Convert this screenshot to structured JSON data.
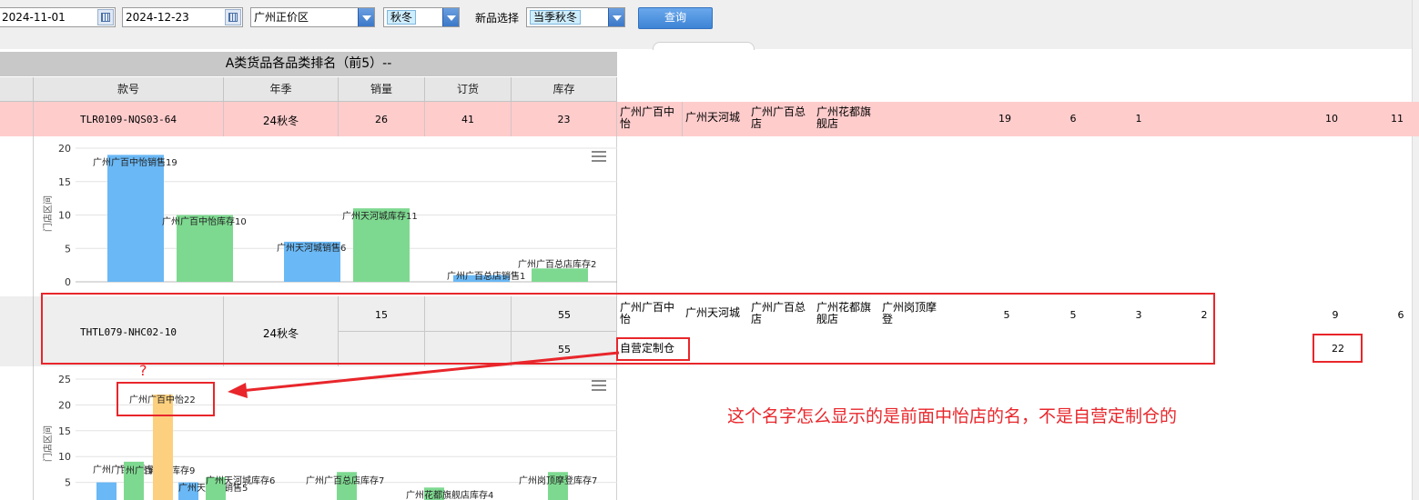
{
  "filters": {
    "start_date": "2024-11-01",
    "end_date": "2024-12-23",
    "region": "广州正价区",
    "season": "秋冬",
    "new_product_label": "新品选择",
    "new_product_value": "当季秋冬",
    "query_label": "查询"
  },
  "table": {
    "title": "A类货品各品类排名（前5）--",
    "headers": [
      "款号",
      "年季",
      "销量",
      "订货",
      "库存"
    ],
    "row1": {
      "style_no": "TLR0109-NQS03-64",
      "season": "24秋冬",
      "sales": "26",
      "order": "41",
      "stock": "23",
      "stores": [
        "广州广百中怡",
        "广州天河城",
        "广州广百总店",
        "广州花都旗舰店"
      ],
      "sales_nums": [
        "19",
        "6",
        "1"
      ],
      "stock_nums": [
        "10",
        "11"
      ]
    },
    "row2": {
      "style_no": "THTL079-NHC02-10",
      "season": "24秋冬",
      "sales": "15",
      "stock": "55",
      "stock_line2": "55",
      "stores": [
        "广州广百中怡",
        "广州天河城",
        "广州广百总店",
        "广州花都旗舰店",
        "广州岗顶摩登"
      ],
      "sales_nums": [
        "5",
        "5",
        "3",
        "2"
      ],
      "stock_nums": [
        "9",
        "6"
      ],
      "warehouse": "自营定制仓",
      "warehouse_num": "22"
    }
  },
  "charts": {
    "y_axis_label": "门店区间"
  },
  "chart_data": [
    {
      "type": "bar",
      "yticks": [
        "0",
        "5",
        "10",
        "15",
        "20"
      ],
      "ylim": [
        0,
        20
      ],
      "series": [
        {
          "label": "广州广百中怡销售19",
          "value": 19,
          "color": "#6ab8f5",
          "kind": "sales"
        },
        {
          "label": "广州广百中怡库存10",
          "value": 10,
          "color": "#7ed990",
          "kind": "stock"
        },
        {
          "label": "广州天河城销售6",
          "value": 6,
          "color": "#6ab8f5",
          "kind": "sales"
        },
        {
          "label": "广州天河城库存11",
          "value": 11,
          "color": "#7ed990",
          "kind": "stock"
        },
        {
          "label": "广州广百总店销售1",
          "value": 1,
          "color": "#6ab8f5",
          "kind": "sales"
        },
        {
          "label": "广州广百总店库存2",
          "value": 2,
          "color": "#7ed990",
          "kind": "stock"
        }
      ]
    },
    {
      "type": "bar",
      "yticks": [
        "5",
        "10",
        "15",
        "20",
        "25"
      ],
      "ylim": [
        0,
        25
      ],
      "series": [
        {
          "label": "广州广百中怡销售5",
          "value": 5,
          "color": "#6ab8f5",
          "kind": "sales"
        },
        {
          "label": "广州广百中怡库存9",
          "value": 9,
          "color": "#7ed990",
          "kind": "stock"
        },
        {
          "label": "广州广百中怡22",
          "value": 22,
          "color": "#fcd07e",
          "kind": "warehouse"
        },
        {
          "label": "广州天河城销售5",
          "value": 5,
          "color": "#6ab8f5",
          "kind": "sales"
        },
        {
          "label": "广州天河城库存6",
          "value": 6,
          "color": "#7ed990",
          "kind": "stock"
        },
        {
          "label": "广州广百总店库存7",
          "value": 7,
          "color": "#7ed990",
          "kind": "stock"
        },
        {
          "label": "广州花都旗舰店库存4",
          "value": 4,
          "color": "#7ed990",
          "kind": "stock"
        },
        {
          "label": "广州岗顶摩登库存7",
          "value": 7,
          "color": "#7ed990",
          "kind": "stock"
        }
      ]
    }
  ],
  "annotation": {
    "text": "这个名字怎么显示的是前面中怡店的名，不是自营定制仓的",
    "question_mark": "?"
  }
}
